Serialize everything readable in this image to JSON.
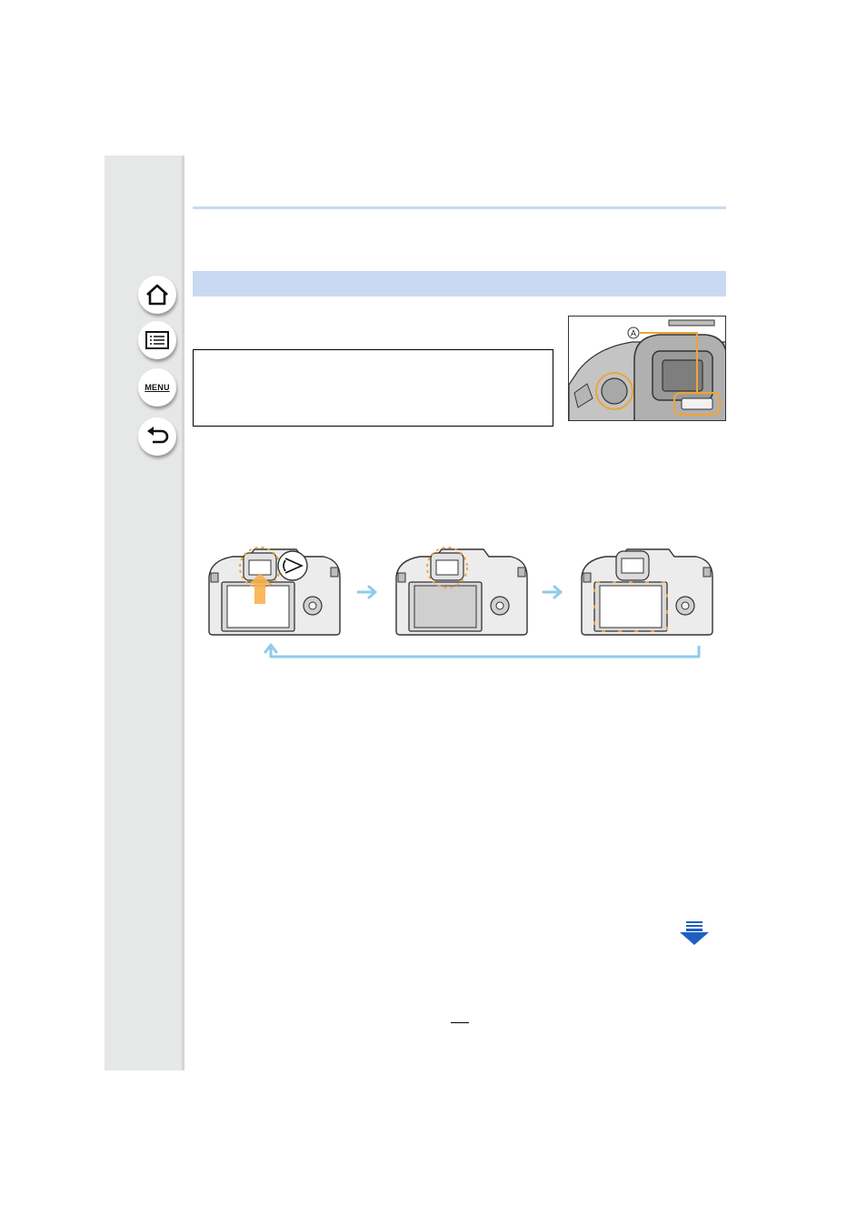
{
  "sidebar": {
    "buttons": [
      {
        "name": "home-button",
        "icon": "home-icon"
      },
      {
        "name": "contents-button",
        "icon": "list-icon"
      },
      {
        "name": "menu-button",
        "icon": "menu-icon",
        "label": "MENU"
      },
      {
        "name": "back-button",
        "icon": "back-arrow-icon"
      }
    ]
  },
  "photo": {
    "callout_label": "A"
  },
  "colors": {
    "accent_band": "#c9d9f3",
    "highlight": "#f0a43a",
    "cycle_arrow": "#8ecbea",
    "next_page_arrow": "#1f5fc4"
  }
}
